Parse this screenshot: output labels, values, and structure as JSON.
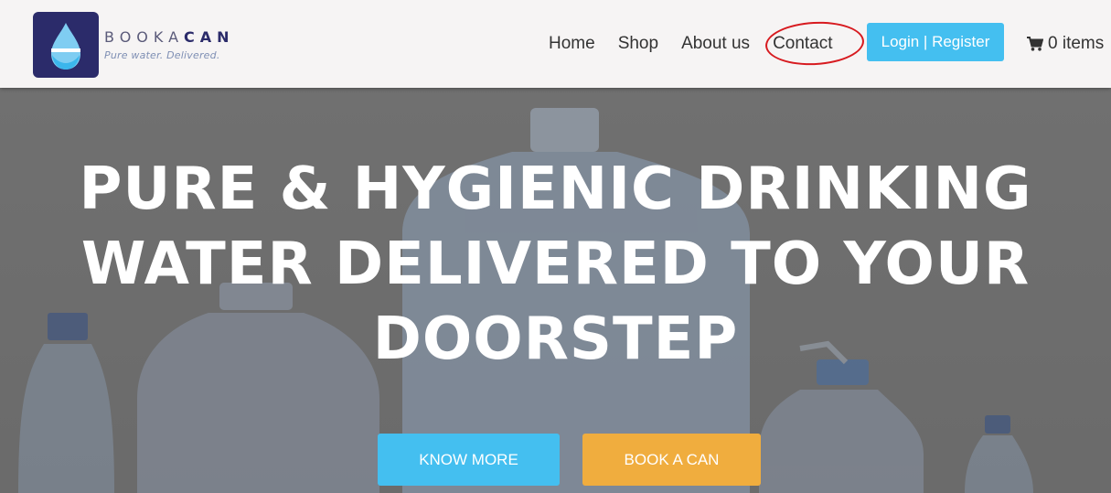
{
  "brand": {
    "name_light": "BOOKA",
    "name_bold": "CAN",
    "tagline": "Pure water. Delivered."
  },
  "nav": {
    "items": [
      "Home",
      "Shop",
      "About us",
      "Contact"
    ],
    "login_label": "Login | Register",
    "cart_label": "0 items"
  },
  "hero": {
    "title_line1": "PURE & HYGIENIC DRINKING",
    "title_line2": "WATER DELIVERED TO YOUR",
    "title_line3": "DOORSTEP",
    "know_more_label": "KNOW MORE",
    "book_label": "BOOK A CAN"
  },
  "colors": {
    "accent_blue": "#44bff0",
    "accent_orange": "#f0ad3e",
    "logo_navy": "#2b2b6a",
    "annotation_red": "#d71a1f"
  }
}
